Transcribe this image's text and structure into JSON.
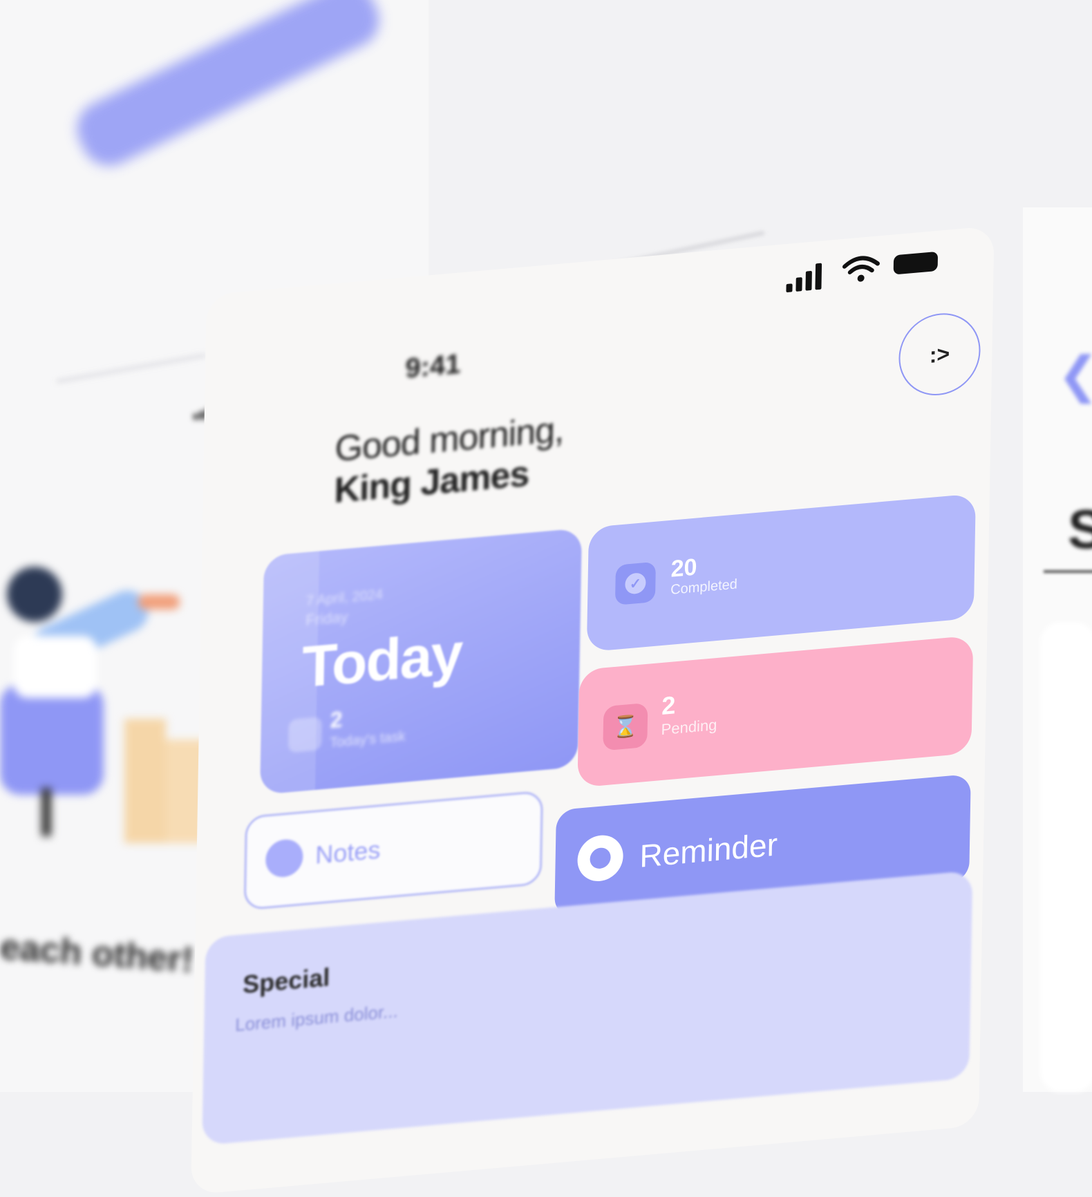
{
  "status_bar": {
    "time": "9:41"
  },
  "profile_button": {
    "label": ":>"
  },
  "greeting": {
    "line1": "Good morning,",
    "line2": "King James"
  },
  "today_card": {
    "date": "7 April, 2024",
    "day": "Friday",
    "title": "Today",
    "count": "2",
    "count_label": "Today's task"
  },
  "completed_card": {
    "count": "20",
    "label": "Completed",
    "icon": "check-icon"
  },
  "pending_card": {
    "count": "2",
    "label": "Pending",
    "icon": "hourglass-icon"
  },
  "notes_button": {
    "label": "Notes",
    "icon": "notes-icon"
  },
  "reminder_button": {
    "label": "Reminder",
    "icon": "ring-icon"
  },
  "special_card": {
    "title": "Special",
    "description": "Lorem ipsum dolor..."
  },
  "background_left": {
    "caption": "each other!"
  },
  "background_right": {
    "heading_letter": "S"
  },
  "colors": {
    "accent": "#8f97f5",
    "accent_light": "#b3b8fb",
    "pink": "#fdb0c9",
    "lavender": "#d6d8fb"
  }
}
